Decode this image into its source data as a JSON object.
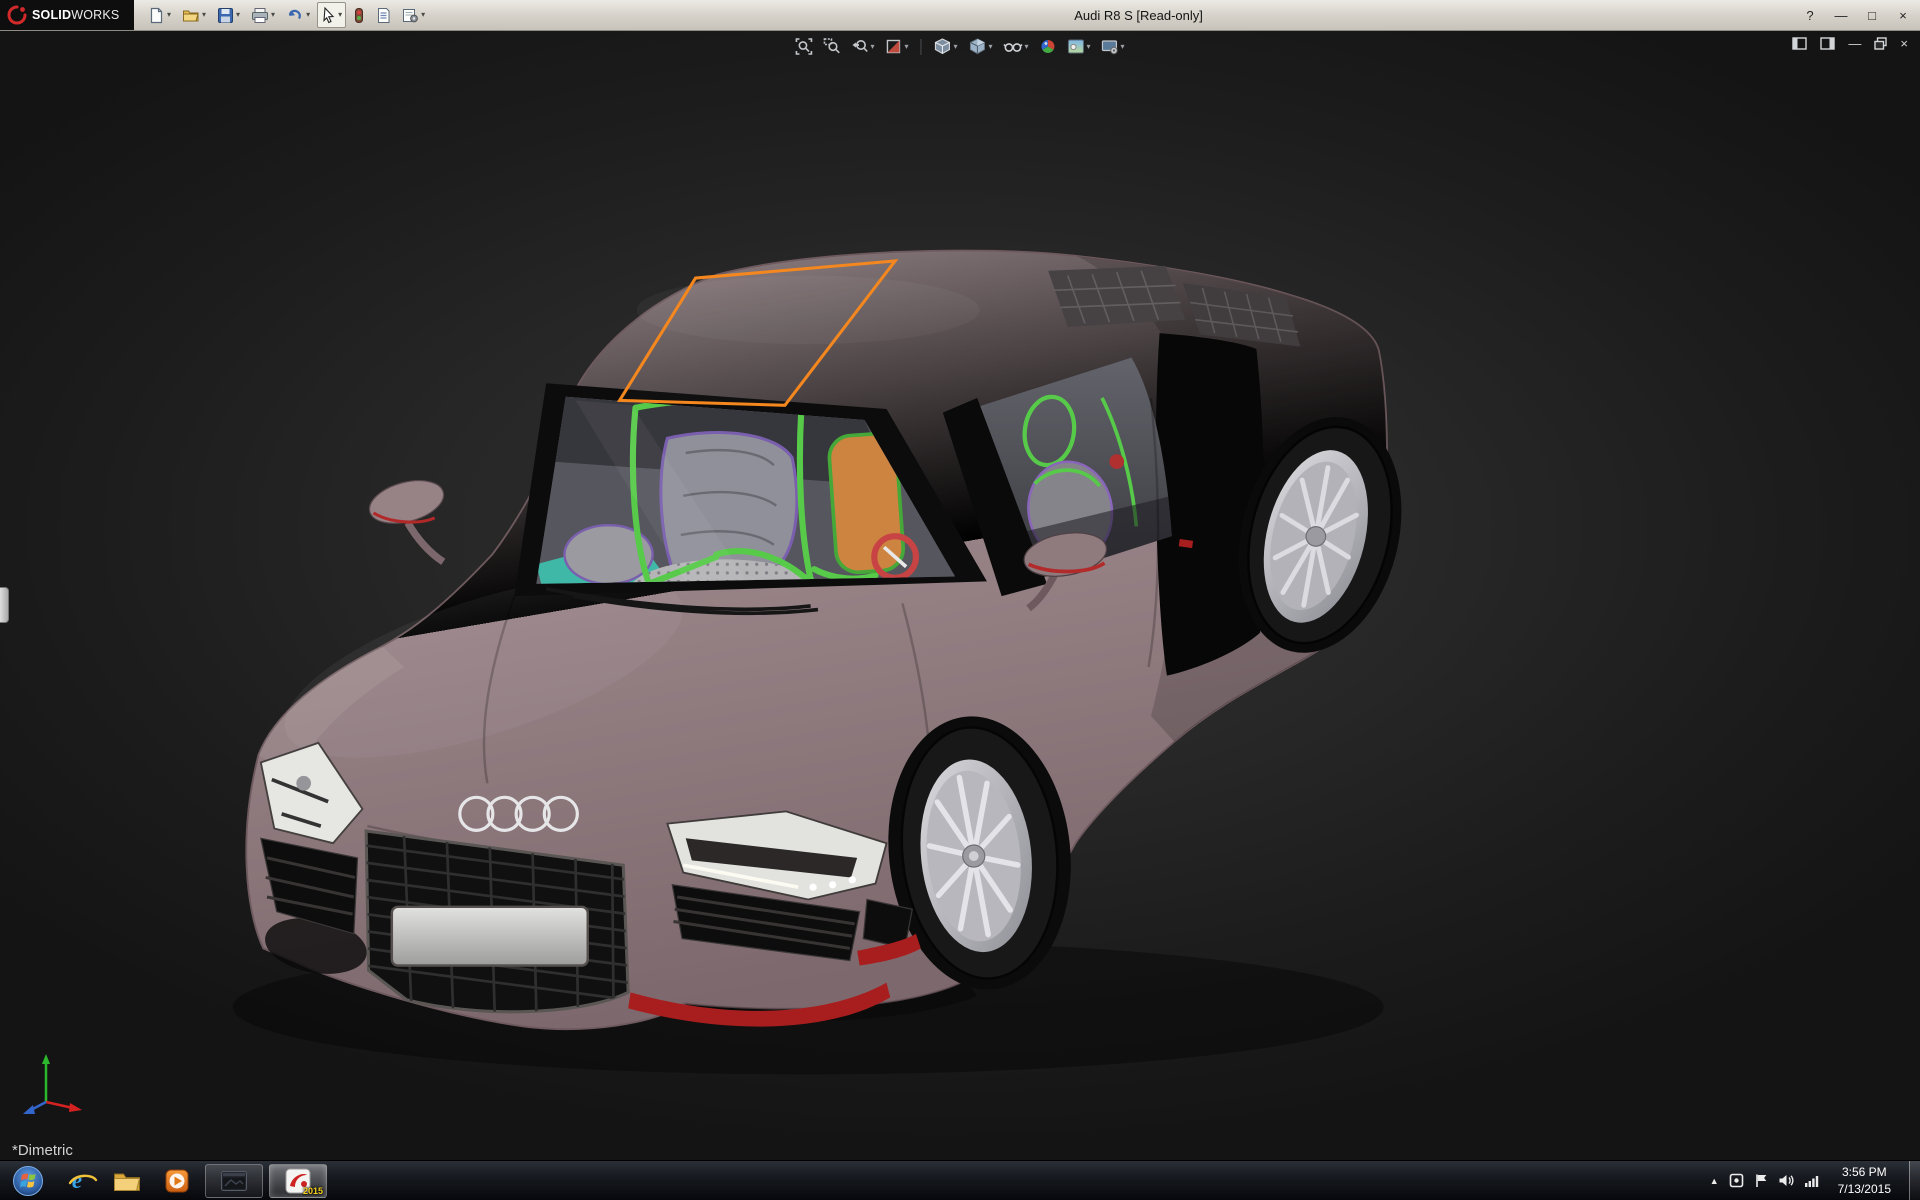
{
  "colors": {
    "body_paint": "#9c8588",
    "selection_orange": "#f5871f",
    "cage_green": "#57cb49",
    "seat_orange": "#cd8440",
    "interior_teal": "#3fb8a8",
    "caliper_blue": "#2b62d9",
    "accent_red": "#a81e1e"
  },
  "titlebar": {
    "brand_solid": "SOLID",
    "brand_works": "WORKS",
    "title": "Audi R8 S [Read-only]"
  },
  "icons": {
    "dropdown": "▾",
    "help": "?",
    "minimize": "—",
    "maximize": "□",
    "close": "×",
    "hidden_icons": "▲"
  },
  "viewport": {
    "orientation_label": "*Dimetric"
  },
  "taskbar": {
    "time": "3:56 PM",
    "date": "7/13/2015",
    "solidworks_badge": "2015"
  }
}
